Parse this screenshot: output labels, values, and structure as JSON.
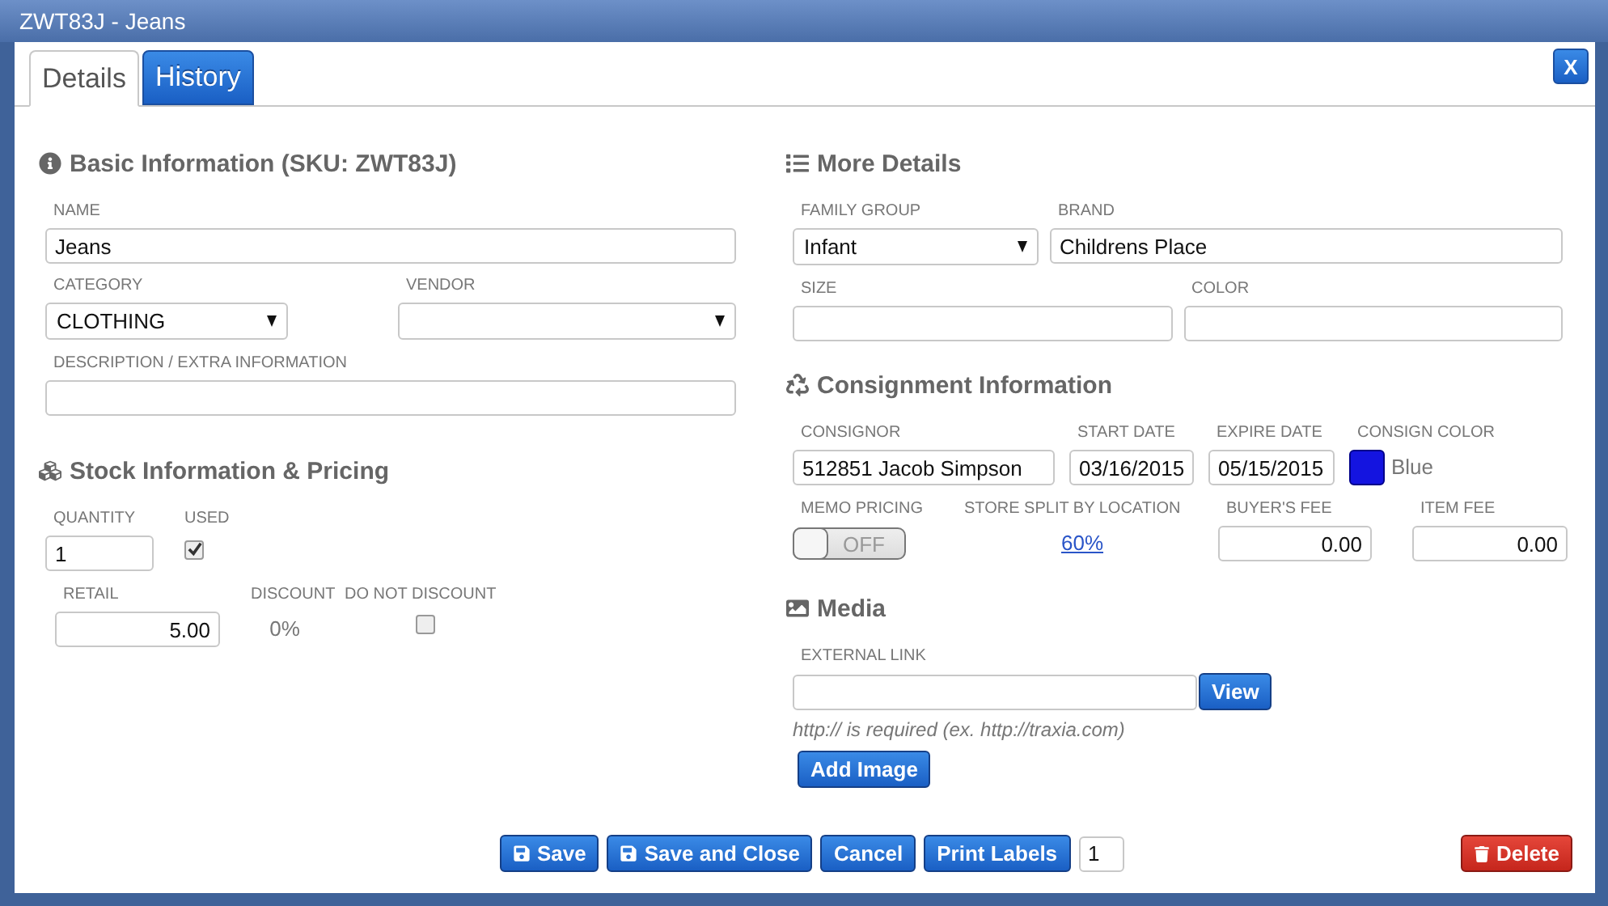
{
  "window": {
    "title": "ZWT83J - Jeans"
  },
  "tabs": [
    {
      "label": "Details",
      "selected": true
    },
    {
      "label": "History",
      "selected": false
    }
  ],
  "close_button": "X",
  "basic": {
    "title": "Basic Information (SKU: ZWT83J)",
    "name": {
      "label": "NAME",
      "value": "Jeans"
    },
    "category": {
      "label": "CATEGORY",
      "value": "CLOTHING"
    },
    "vendor": {
      "label": "VENDOR"
    },
    "description": {
      "label": "DESCRIPTION / EXTRA INFORMATION"
    }
  },
  "stock": {
    "title": "Stock Information & Pricing",
    "quantity": {
      "label": "QUANTITY",
      "value": "1"
    },
    "used": {
      "label": "USED",
      "checked": true
    },
    "retail": {
      "label": "RETAIL",
      "value": "5.00"
    },
    "discount": {
      "label": "DISCOUNT",
      "value": "0%"
    },
    "do_not_discount": {
      "label": "DO NOT DISCOUNT",
      "checked": false
    }
  },
  "more": {
    "title": "More Details",
    "family_group": {
      "label": "FAMILY GROUP",
      "value": "Infant"
    },
    "brand": {
      "label": "BRAND",
      "value": "Childrens Place"
    },
    "size": {
      "label": "SIZE"
    },
    "color": {
      "label": "COLOR"
    }
  },
  "consignment": {
    "title": "Consignment Information",
    "consignor": {
      "label": "CONSIGNOR",
      "value": "512851 Jacob Simpson"
    },
    "start_date": {
      "label": "START DATE",
      "value": "03/16/2015"
    },
    "expire_date": {
      "label": "EXPIRE DATE",
      "value": "05/15/2015"
    },
    "consign_color": {
      "label": "CONSIGN COLOR",
      "value": "Blue",
      "color": "#1414e0"
    },
    "memo_pricing": {
      "label": "MEMO PRICING",
      "on": false,
      "text": "OFF"
    },
    "store_split": {
      "label": "STORE SPLIT BY LOCATION",
      "value": "60%"
    },
    "buyers_fee": {
      "label": "BUYER'S FEE",
      "value": "0.00"
    },
    "item_fee": {
      "label": "ITEM FEE",
      "value": "0.00"
    }
  },
  "media": {
    "title": "Media",
    "external_link": {
      "label": "EXTERNAL LINK"
    },
    "view_button": "View",
    "hint": "http:// is required (ex. http://traxia.com)",
    "add_image_button": "Add Image"
  },
  "footer": {
    "buttons": [
      {
        "label": "Save",
        "kind": "save"
      },
      {
        "label": "Save and Close",
        "kind": "save"
      },
      {
        "label": "Cancel",
        "kind": "plain"
      },
      {
        "label": "Print Labels",
        "kind": "plain"
      }
    ],
    "print_count": "1",
    "delete_button": "Delete"
  }
}
